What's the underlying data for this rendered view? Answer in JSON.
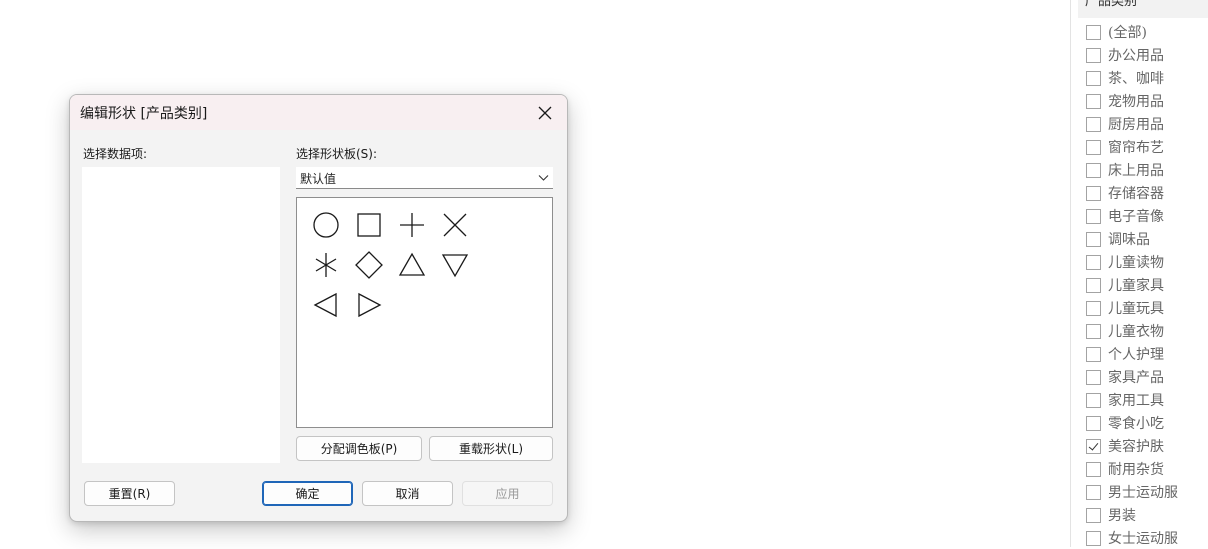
{
  "filter": {
    "header": "产品类别",
    "items": [
      {
        "label": "(全部)",
        "checked": false
      },
      {
        "label": "办公用品",
        "checked": false
      },
      {
        "label": "茶、咖啡",
        "checked": false
      },
      {
        "label": "宠物用品",
        "checked": false
      },
      {
        "label": "厨房用品",
        "checked": false
      },
      {
        "label": "窗帘布艺",
        "checked": false
      },
      {
        "label": "床上用品",
        "checked": false
      },
      {
        "label": "存储容器",
        "checked": false
      },
      {
        "label": "电子音像",
        "checked": false
      },
      {
        "label": "调味品",
        "checked": false
      },
      {
        "label": "儿童读物",
        "checked": false
      },
      {
        "label": "儿童家具",
        "checked": false
      },
      {
        "label": "儿童玩具",
        "checked": false
      },
      {
        "label": "儿童衣物",
        "checked": false
      },
      {
        "label": "个人护理",
        "checked": false
      },
      {
        "label": "家具产品",
        "checked": false
      },
      {
        "label": "家用工具",
        "checked": false
      },
      {
        "label": "零食小吃",
        "checked": false
      },
      {
        "label": "美容护肤",
        "checked": true
      },
      {
        "label": "耐用杂货",
        "checked": false
      },
      {
        "label": "男士运动服",
        "checked": false
      },
      {
        "label": "男装",
        "checked": false
      },
      {
        "label": "女士运动服",
        "checked": false
      }
    ]
  },
  "dialog": {
    "title": "编辑形状 [产品类别]",
    "data_items_label": "选择数据项:",
    "palette_label": "选择形状板(S):",
    "palette_value": "默认值",
    "shapes": [
      "circle-icon",
      "square-icon",
      "plus-icon",
      "cross-icon",
      "asterisk-icon",
      "diamond-icon",
      "triangle-up-icon",
      "triangle-down-icon",
      "triangle-left-icon",
      "triangle-right-icon"
    ],
    "assign_palette_label": "分配调色板(P)",
    "reload_shapes_label": "重载形状(L)",
    "reset_label": "重置(R)",
    "ok_label": "确定",
    "cancel_label": "取消",
    "apply_label": "应用",
    "accent_color": "#1f66b8"
  }
}
